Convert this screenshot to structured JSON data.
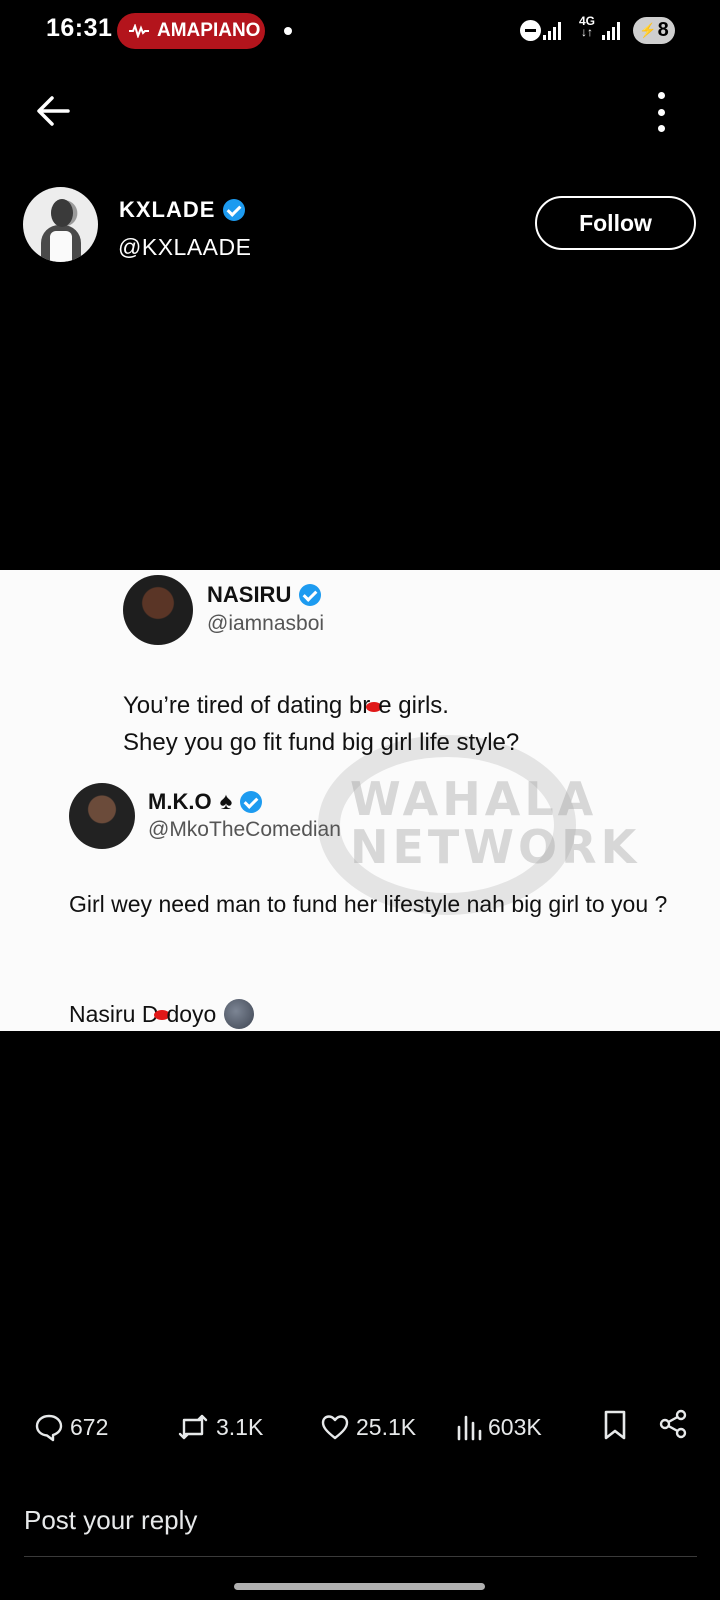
{
  "status_bar": {
    "time": "16:31",
    "now_playing": "AMAPIANO",
    "network": "4G",
    "battery": "8"
  },
  "header": {
    "back_icon": "arrow-left-icon",
    "more_icon": "more-vertical-icon"
  },
  "author": {
    "display_name": "KXLADE",
    "handle": "@KXLAADE",
    "verified": true,
    "follow_label": "Follow"
  },
  "media": {
    "watermark_line1": "WAHALA",
    "watermark_line2": "NETWORK",
    "tweet1": {
      "name": "NASIRU",
      "handle": "@iamnasboi",
      "line1_a": "You’re tired of dating br",
      "line1_b": "e girls.",
      "line2": "Shey you go fit fund big girl life style?"
    },
    "tweet2": {
      "name": "M.K.O",
      "spade": "♠",
      "handle": "@MkoTheComedian",
      "text": "Girl wey need man  to fund her lifestyle nah big girl to you ?",
      "sign_a": "Nasiru D",
      "sign_b": "doyo"
    }
  },
  "actions": {
    "replies": "672",
    "reposts": "3.1K",
    "likes": "25.1K",
    "views": "603K"
  },
  "reply": {
    "placeholder": "Post your reply"
  },
  "colors": {
    "background": "#000000",
    "verified_blue": "#1d9bf0",
    "now_playing_red": "#b3141c"
  }
}
